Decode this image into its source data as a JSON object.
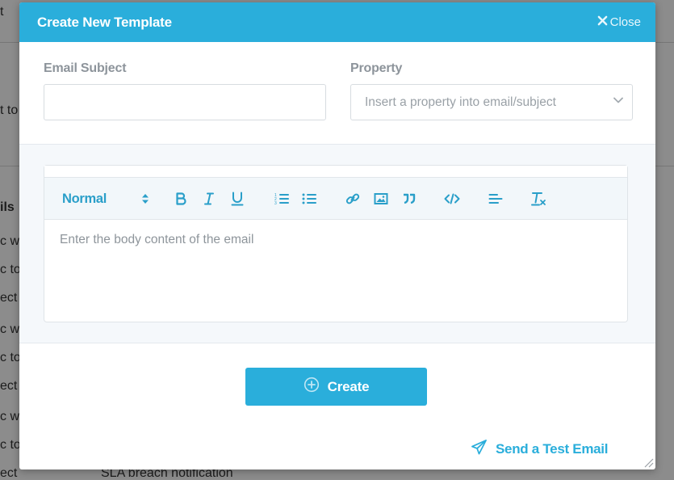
{
  "background": {
    "fragments": [
      "t",
      "t to",
      "ils",
      "c wh",
      "c to",
      "ect",
      "c wh",
      "c to",
      "ect",
      "c wh",
      "c to",
      "ect",
      "SLA breach notification"
    ]
  },
  "modal": {
    "title": "Create New Template",
    "close_label": "Close"
  },
  "fields": {
    "subject_label": "Email Subject",
    "subject_value": "",
    "property_label": "Property",
    "property_placeholder": "Insert a property into email/subject"
  },
  "editor": {
    "format_value": "Normal",
    "toolbar_icons": [
      "format-select",
      "bold",
      "italic",
      "underline",
      "ordered-list",
      "bullet-list",
      "link",
      "image",
      "blockquote",
      "code",
      "align",
      "clear-format"
    ],
    "body_placeholder": "Enter the body content of the email"
  },
  "actions": {
    "create_label": "Create",
    "test_email_label": "Send a Test Email"
  },
  "colors": {
    "accent": "#2aaedb",
    "toolbar_icon": "#2a9fc9"
  }
}
